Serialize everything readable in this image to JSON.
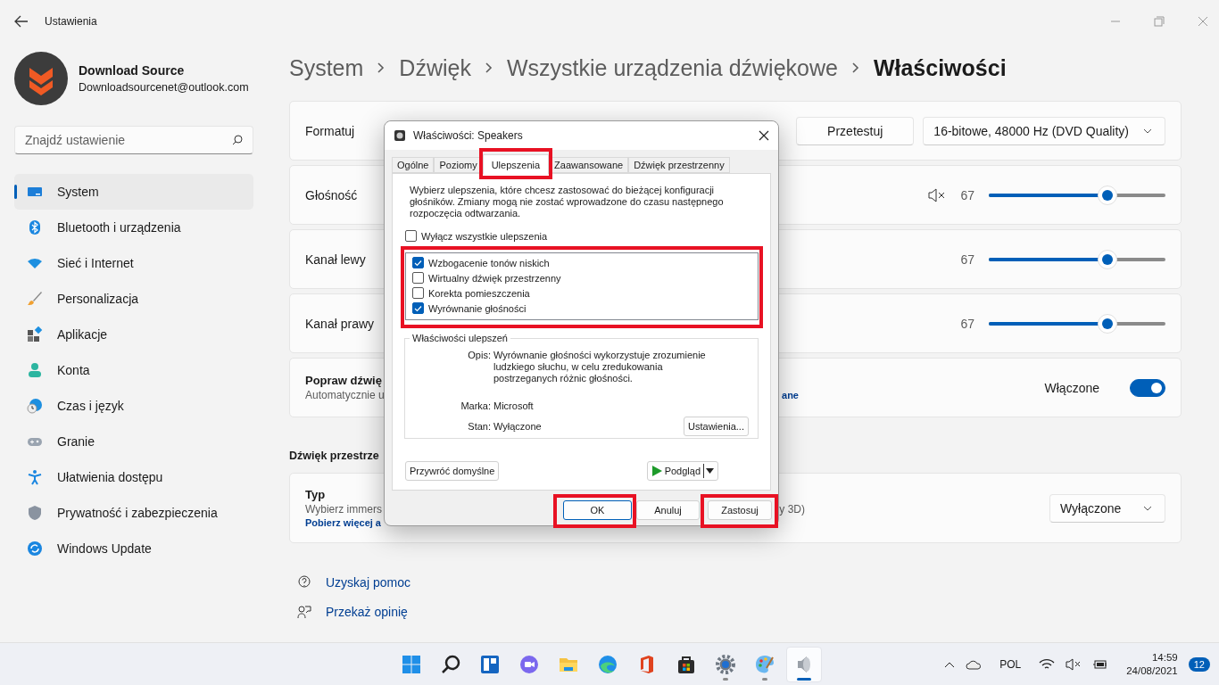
{
  "window": {
    "title": "Ustawienia"
  },
  "profile": {
    "name": "Download Source",
    "email": "Downloadsourcenet@outlook.com"
  },
  "search": {
    "placeholder": "Znajdź ustawienie"
  },
  "nav": [
    {
      "label": "System",
      "selected": true
    },
    {
      "label": "Bluetooth i urządzenia",
      "selected": false
    },
    {
      "label": "Sieć i Internet",
      "selected": false
    },
    {
      "label": "Personalizacja",
      "selected": false
    },
    {
      "label": "Aplikacje",
      "selected": false
    },
    {
      "label": "Konta",
      "selected": false
    },
    {
      "label": "Czas i język",
      "selected": false
    },
    {
      "label": "Granie",
      "selected": false
    },
    {
      "label": "Ułatwienia dostępu",
      "selected": false
    },
    {
      "label": "Prywatność i zabezpieczenia",
      "selected": false
    },
    {
      "label": "Windows Update",
      "selected": false
    }
  ],
  "breadcrumb": [
    "System",
    "Dźwięk",
    "Wszystkie urządzenia dźwiękowe",
    "Właściwości"
  ],
  "format": {
    "label": "Formatuj",
    "test_button": "Przetestuj",
    "value": "16-bitowe, 48000 Hz (DVD Quality)"
  },
  "levels": [
    {
      "kind": "master",
      "label": "Głośność",
      "reading": "67",
      "level": 0.67
    },
    {
      "kind": "channel",
      "label": "Kanał lewy",
      "reading": "67",
      "level": 0.67
    },
    {
      "kind": "channel",
      "label": "Kanał prawy",
      "reading": "67",
      "level": 0.67
    }
  ],
  "enhance": {
    "title": "Popraw dźwię",
    "description": "Automatycznie u",
    "link_tail": "ane",
    "status": "Włączone",
    "on": true
  },
  "spatial": {
    "heading": "Dźwięk przestrze",
    "title": "Typ",
    "description": "Wybierz immers",
    "description_tail": "y 3D)",
    "link": "Pobierz więcej a",
    "value": "Wyłączone"
  },
  "help": [
    {
      "label": "Uzyskaj pomoc"
    },
    {
      "label": "Przekaż opinię"
    }
  ],
  "dialog": {
    "title": "Właściwości: Speakers",
    "tabs": [
      {
        "label": "Ogólne",
        "selected": false,
        "highlighted": false
      },
      {
        "label": "Poziomy",
        "selected": false,
        "highlighted": false
      },
      {
        "label": "Ulepszenia",
        "selected": true,
        "highlighted": true
      },
      {
        "label": "Zaawansowane",
        "selected": false,
        "highlighted": false
      },
      {
        "label": "Dźwięk przestrzenny",
        "selected": false,
        "highlighted": false
      }
    ],
    "intro": "Wybierz ulepszenia, które chcesz zastosować do bieżącej konfiguracji głośników. Zmiany mogą nie zostać wprowadzone do czasu następnego rozpoczęcia odtwarzania.",
    "disable_all": {
      "label": "Wyłącz wszystkie ulepszenia",
      "checked": false
    },
    "enhancements": {
      "highlighted": true,
      "items": [
        {
          "label": "Wzbogacenie tonów niskich",
          "checked": true
        },
        {
          "label": "Wirtualny dźwięk przestrzenny",
          "checked": false
        },
        {
          "label": "Korekta pomieszczenia",
          "checked": false
        },
        {
          "label": "Wyrównanie głośności",
          "checked": true
        }
      ]
    },
    "properties": {
      "title": "Właściwości ulepszeń",
      "rows": [
        {
          "label": "Opis:",
          "value": "Wyrównanie głośności wykorzystuje zrozumienie ludzkiego słuchu, w celu zredukowania postrzeganych różnic głośności."
        },
        {
          "label": "Marka:",
          "value": "Microsoft"
        },
        {
          "label": "Stan:",
          "value": "Wyłączone"
        }
      ],
      "settings_button": "Ustawienia..."
    },
    "restore_button": "Przywróć domyślne",
    "preview_button": "Podgląd",
    "buttons": [
      {
        "label": "OK",
        "highlighted": true,
        "default": true
      },
      {
        "label": "Anuluj",
        "highlighted": false,
        "default": false
      },
      {
        "label": "Zastosuj",
        "highlighted": true,
        "default": false
      }
    ]
  },
  "taskbar": {
    "apps": [
      {
        "running": false,
        "selected": false
      },
      {
        "running": false,
        "selected": false
      },
      {
        "running": false,
        "selected": false
      },
      {
        "running": false,
        "selected": false
      },
      {
        "running": false,
        "selected": false
      },
      {
        "running": false,
        "selected": false
      },
      {
        "running": false,
        "selected": false
      },
      {
        "running": false,
        "selected": false
      },
      {
        "running": true,
        "selected": false
      },
      {
        "running": true,
        "selected": false
      },
      {
        "running": true,
        "selected": true
      }
    ],
    "language": "POL",
    "time": "14:59",
    "date": "24/08/2021",
    "notifications": "12"
  }
}
